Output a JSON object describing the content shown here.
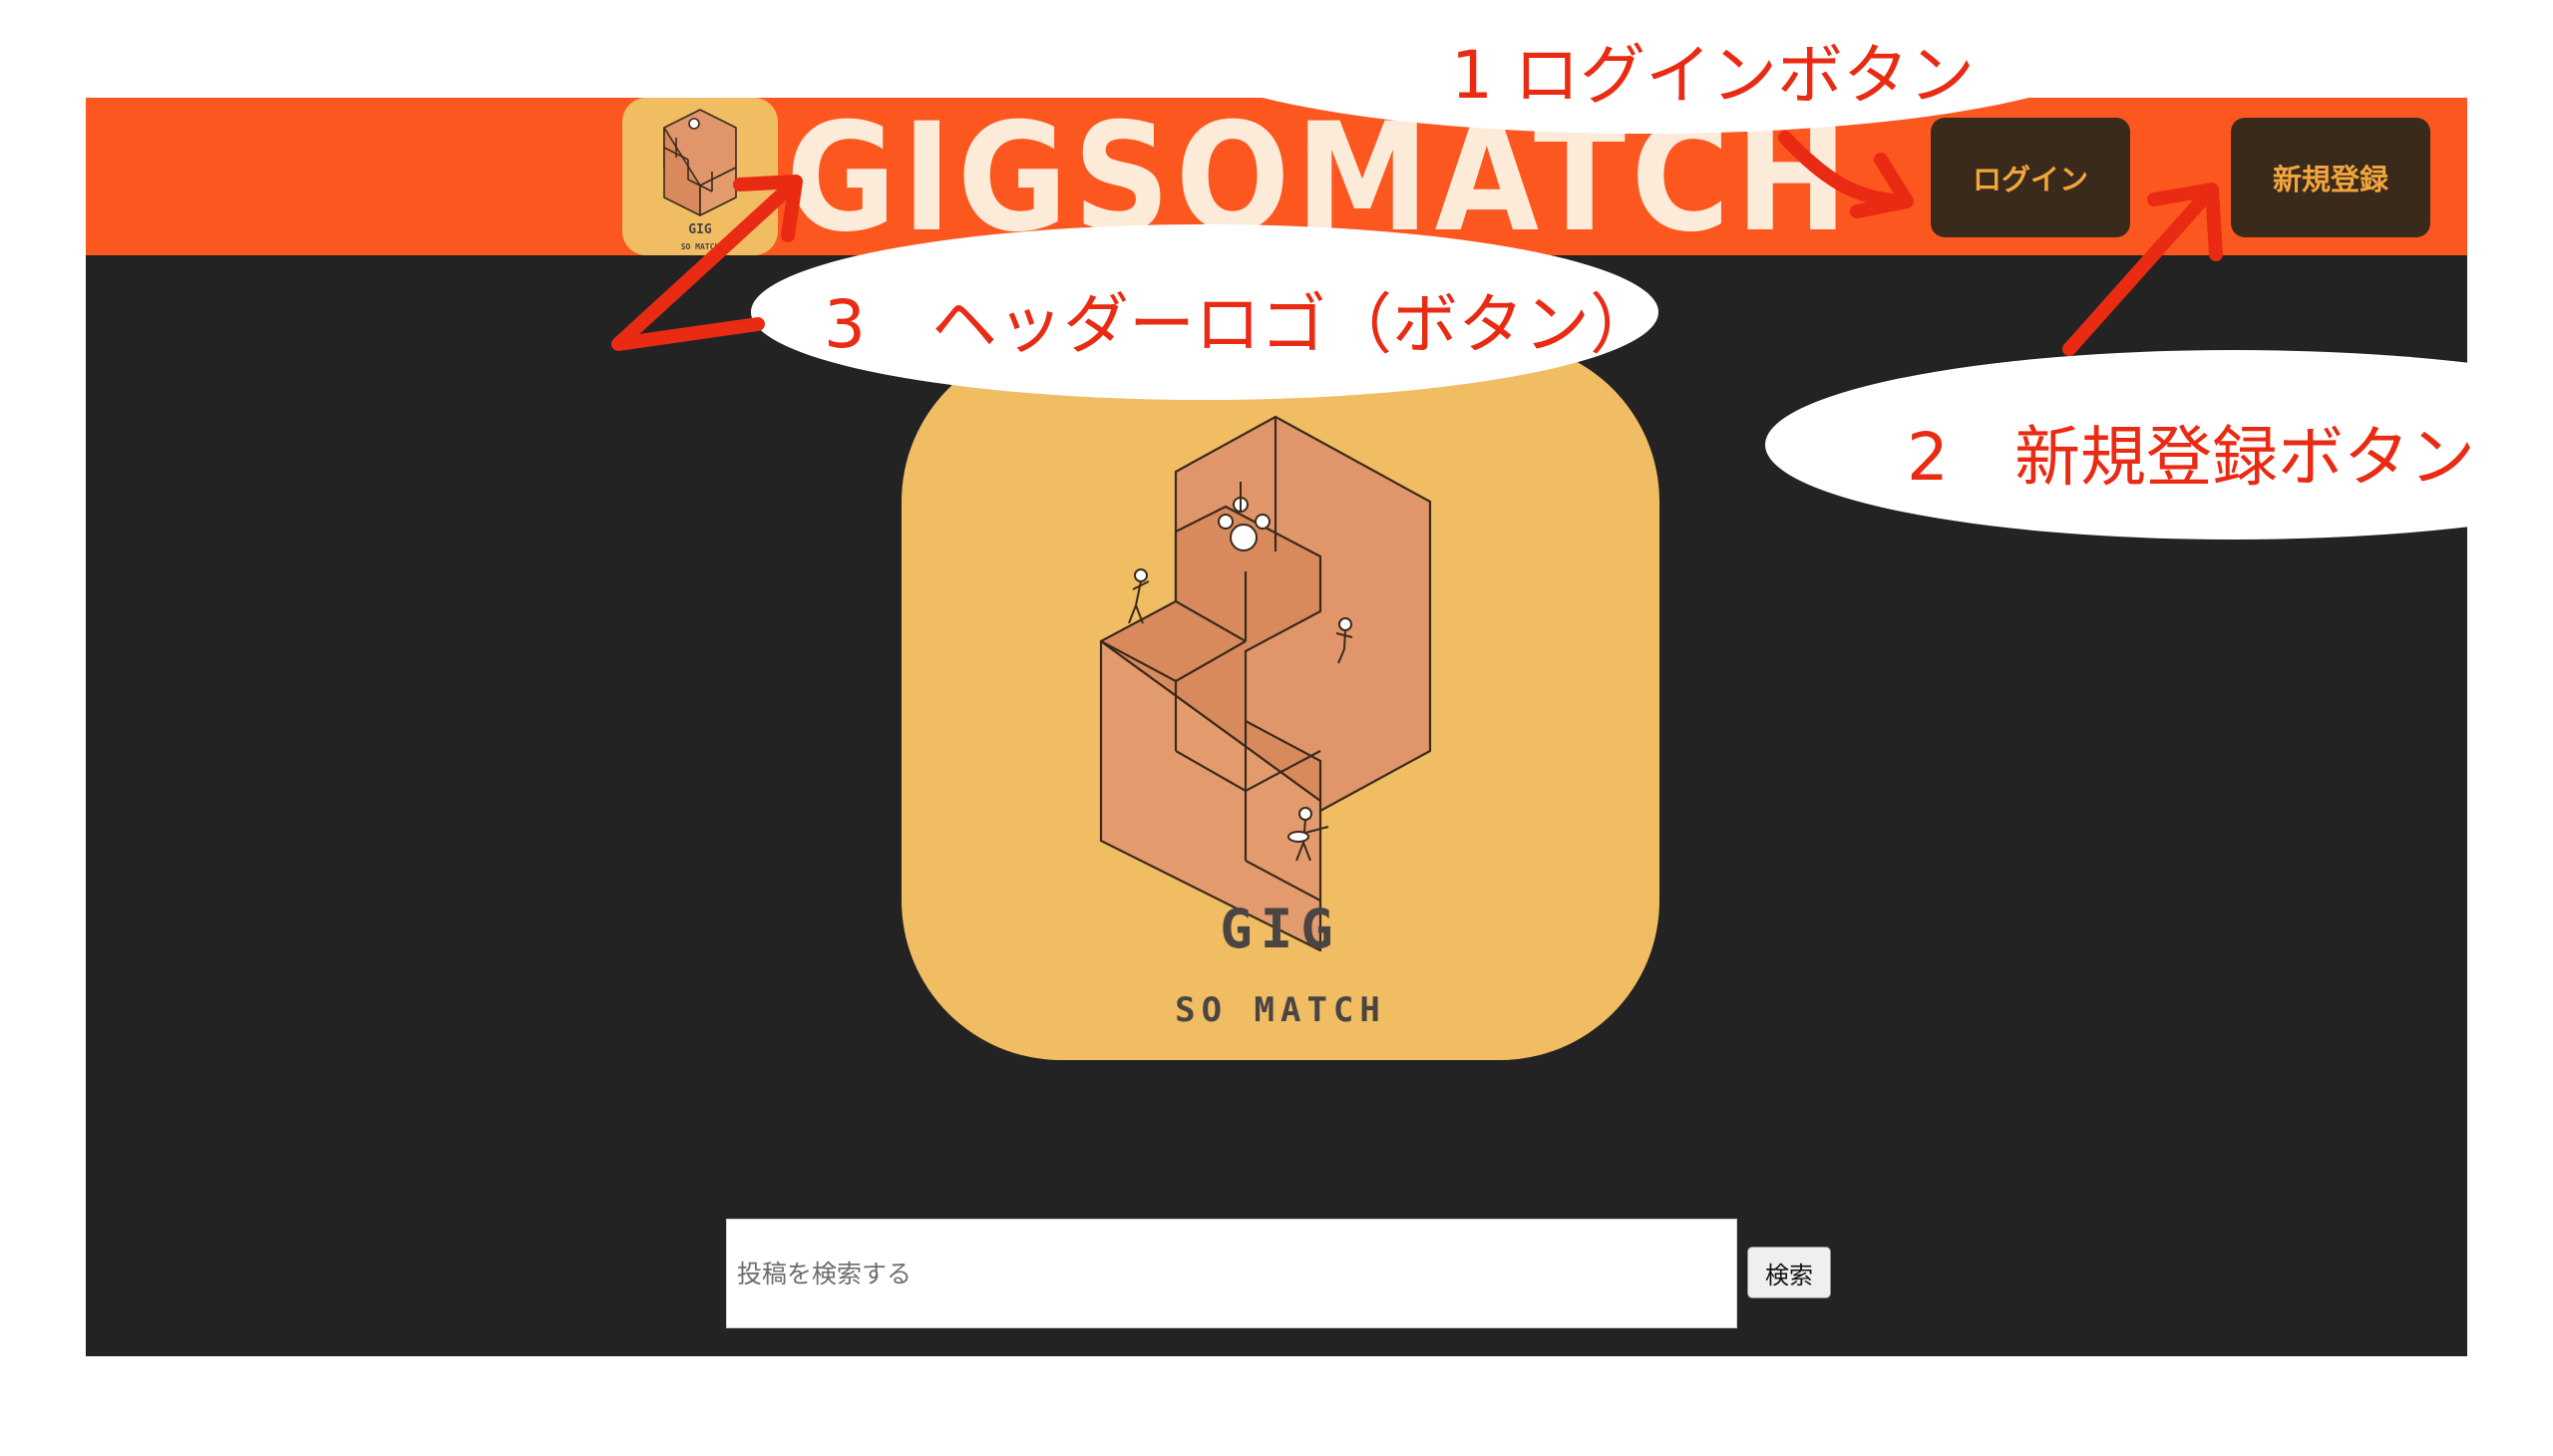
{
  "header": {
    "logo_caption_top": "GIG",
    "logo_caption_bottom": "SO MATCH",
    "wordmark": "GIGSOMATCH",
    "login_label": "ログイン",
    "signup_label": "新規登録"
  },
  "hero": {
    "title": "GIG",
    "subtitle": "SO MATCH"
  },
  "search": {
    "placeholder": "投稿を検索する",
    "button_label": "検索"
  },
  "annotations": {
    "login": "1 ログインボタン",
    "signup": "2　新規登録ボタン",
    "header_logo": "3　ヘッダーロゴ（ボタン）"
  },
  "colors": {
    "header_bg": "#fd5720",
    "page_bg": "#232323",
    "logo_tile": "#f0bd63",
    "button_bg": "#3a2a1c",
    "button_text": "#f3a53d",
    "annotation_red": "#ea2b13"
  }
}
